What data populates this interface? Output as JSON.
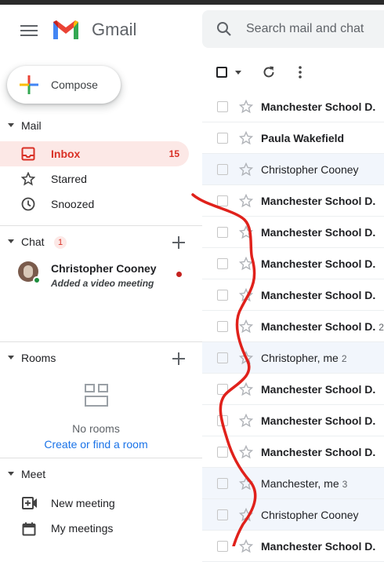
{
  "header": {
    "app_title": "Gmail",
    "search_placeholder": "Search mail and chat",
    "colors": {
      "background": "#ffffff",
      "search_bg": "#f1f3f4"
    }
  },
  "sidebar": {
    "compose_label": "Compose",
    "mail_section": "Mail",
    "items": [
      {
        "label": "Inbox",
        "count": "15",
        "icon": "inbox-icon",
        "active": true
      },
      {
        "label": "Starred",
        "icon": "star-icon"
      },
      {
        "label": "Snoozed",
        "icon": "clock-icon"
      }
    ],
    "chat": {
      "section": "Chat",
      "badge": "1",
      "contact_name": "Christopher Cooney",
      "contact_status": "Added a video meeting"
    },
    "rooms": {
      "section": "Rooms",
      "empty_text": "No rooms",
      "create_link": "Create or find a room"
    },
    "meet": {
      "section": "Meet",
      "items": [
        {
          "label": "New meeting",
          "icon": "video-plus-icon"
        },
        {
          "label": "My meetings",
          "icon": "calendar-icon"
        }
      ]
    },
    "colors": {
      "active_bg": "#fce8e6",
      "active_text": "#d93025",
      "link": "#1a73e8"
    }
  },
  "emails": [
    {
      "sender": "Manchester School D.",
      "count": "",
      "unread": true
    },
    {
      "sender": "Paula Wakefield",
      "count": "",
      "unread": true
    },
    {
      "sender": "Christopher Cooney",
      "count": "",
      "unread": false
    },
    {
      "sender": "Manchester School D.",
      "count": "",
      "unread": true
    },
    {
      "sender": "Manchester School D.",
      "count": "",
      "unread": true
    },
    {
      "sender": "Manchester School D.",
      "count": "",
      "unread": true
    },
    {
      "sender": "Manchester School D.",
      "count": "",
      "unread": true
    },
    {
      "sender": "Manchester School D.",
      "count": "2",
      "unread": true
    },
    {
      "sender": "Christopher, me",
      "count": "2",
      "unread": false
    },
    {
      "sender": "Manchester School D.",
      "count": "",
      "unread": true
    },
    {
      "sender": "Manchester School D.",
      "count": "",
      "unread": true
    },
    {
      "sender": "Manchester School D.",
      "count": "",
      "unread": true
    },
    {
      "sender": "Manchester, me",
      "count": "3",
      "unread": false
    },
    {
      "sender": "Christopher Cooney",
      "count": "",
      "unread": false
    },
    {
      "sender": "Manchester School D.",
      "count": "",
      "unread": true
    }
  ],
  "annotation": {
    "color": "#e0211b"
  }
}
